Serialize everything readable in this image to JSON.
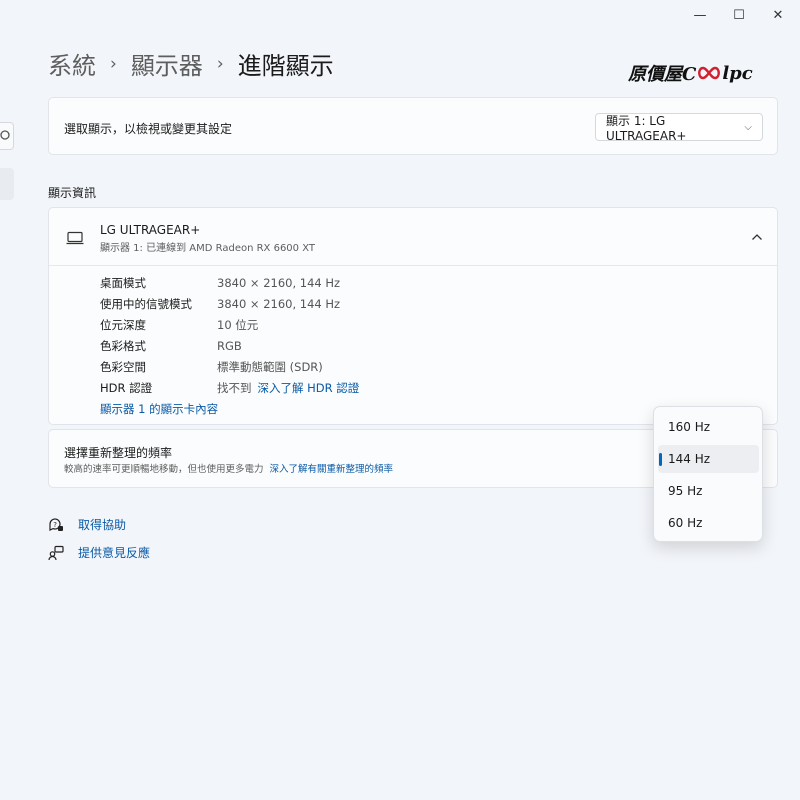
{
  "window": {
    "minimize_glyph": "—",
    "maximize_glyph": "☐",
    "close_glyph": "✕"
  },
  "breadcrumb": {
    "items": [
      "系統",
      "顯示器",
      "進階顯示"
    ],
    "separator": "›"
  },
  "watermark": {
    "prefix": "原價屋C",
    "suffix": "lpc"
  },
  "select_display": {
    "label": "選取顯示，以檢視或變更其設定",
    "value": "顯示 1: LG ULTRAGEAR+",
    "chevron": "⌵"
  },
  "display_info": {
    "section_title": "顯示資訊",
    "monitor_name": "LG ULTRAGEAR+",
    "monitor_sub": "顯示器 1: 已連線到 AMD Radeon RX 6600 XT",
    "collapse_chevron": "⌃",
    "rows": [
      {
        "key": "桌面模式",
        "value": "3840 × 2160, 144 Hz"
      },
      {
        "key": "使用中的信號模式",
        "value": "3840 × 2160, 144 Hz"
      },
      {
        "key": "位元深度",
        "value": "10 位元"
      },
      {
        "key": "色彩格式",
        "value": "RGB"
      },
      {
        "key": "色彩空間",
        "value": "標準動態範圍 (SDR)"
      },
      {
        "key": "HDR 認證",
        "value": "找不到",
        "link": "深入了解 HDR 認證"
      }
    ],
    "adapter_link": "顯示器 1 的顯示卡內容"
  },
  "refresh_rate": {
    "title": "選擇重新整理的頻率",
    "desc": "較高的速率可更順暢地移動，但也使用更多電力",
    "link": "深入了解有關重新整理的頻率",
    "options": [
      "160 Hz",
      "144 Hz",
      "95 Hz",
      "60 Hz"
    ],
    "selected": "144 Hz"
  },
  "help": {
    "get_help": "取得協助",
    "feedback": "提供意見反應"
  },
  "colors": {
    "accent": "#0067c0",
    "link": "#0a5aa7",
    "background": "#f2f5f9",
    "card": "#fbfcfd",
    "watermark_red": "#d2202f"
  },
  "icons": [
    "monitor-icon",
    "help-icon",
    "feedback-icon",
    "chevron-up-icon",
    "chevron-down-icon"
  ]
}
